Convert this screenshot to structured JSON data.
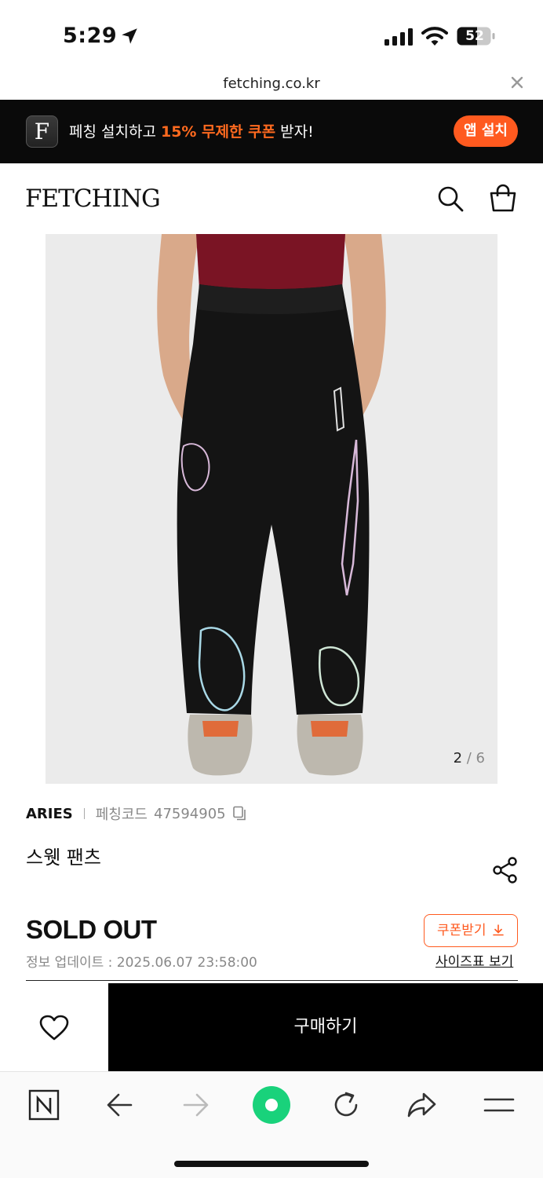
{
  "status_bar": {
    "time": "5:29",
    "battery": "52",
    "icons": [
      "location-arrow-icon",
      "cell-signal-icon",
      "wifi-icon",
      "battery-icon"
    ]
  },
  "browser": {
    "url": "fetching.co.kr"
  },
  "app_banner": {
    "text_before": "페칭 설치하고 ",
    "highlight": "15% 무제한 쿠폰",
    "text_after": " 받자!",
    "app_icon_letter": "F",
    "install_label": "앱 설치",
    "accent_color": "#ff5a1f"
  },
  "header": {
    "logo": "FETCHING",
    "icons": [
      "search-icon",
      "shopping-bag-icon"
    ]
  },
  "gallery": {
    "current": "2",
    "separator": " / ",
    "total": "6"
  },
  "product": {
    "brand": "ARIES",
    "code_label": "페칭코드",
    "code": "47594905",
    "name": "스웻 팬츠",
    "status": "SOLD OUT",
    "update_info": "정보 업데이트 : 2025.06.07 23:58:00",
    "coupon_label": "쿠폰받기",
    "size_chart_label": "사이즈표 보기"
  },
  "actions": {
    "buy_label": "구매하기"
  },
  "toolbar": {
    "icons": [
      "naver-home-icon",
      "back-arrow-icon",
      "forward-arrow-icon",
      "green-dot-icon",
      "reload-icon",
      "share-arrow-icon",
      "menu-icon"
    ]
  }
}
